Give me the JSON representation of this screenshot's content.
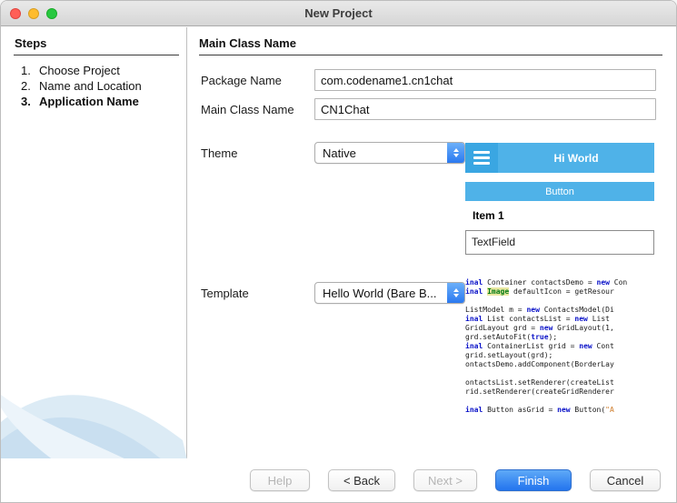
{
  "window": {
    "title": "New Project"
  },
  "colors": {
    "accent_blue": "#2f7cf6",
    "preview_header_blue": "#4fb2e8",
    "preview_burger_blue": "#3aa6e2",
    "keyword_blue": "#0a12c8",
    "string_orange": "#ce7b29",
    "highlight_bg": "#e9e7a1",
    "highlight_green": "#067d17"
  },
  "steps": {
    "heading": "Steps",
    "items": [
      {
        "num": "1.",
        "label": "Choose Project"
      },
      {
        "num": "2.",
        "label": "Name and Location"
      },
      {
        "num": "3.",
        "label": "Application Name"
      }
    ]
  },
  "main": {
    "heading": "Main Class Name",
    "package_label": "Package Name",
    "package_value": "com.codename1.cn1chat",
    "mainclass_label": "Main Class Name",
    "mainclass_value": "CN1Chat",
    "theme_label": "Theme",
    "theme_value": "Native",
    "template_label": "Template",
    "template_value": "Hello World (Bare B...",
    "theme_preview": {
      "title": "Hi World",
      "button": "Button",
      "item": "Item 1",
      "textfield": "TextField"
    },
    "code_lines": [
      [
        {
          "t": "inal ",
          "c": "k"
        },
        {
          "t": "Container contactsDemo = ",
          "c": "p"
        },
        {
          "t": "new",
          "c": "k"
        },
        {
          "t": " Con",
          "c": "p"
        }
      ],
      [
        {
          "t": "inal ",
          "c": "k"
        },
        {
          "t": "Image",
          "c": "h"
        },
        {
          "t": " defaultIcon = getResour",
          "c": "p"
        }
      ],
      [],
      [
        {
          "t": "ListModel m = ",
          "c": "p"
        },
        {
          "t": "new",
          "c": "k"
        },
        {
          "t": " ContactsModel(Di",
          "c": "p"
        }
      ],
      [
        {
          "t": "inal ",
          "c": "k"
        },
        {
          "t": "List contactsList = ",
          "c": "p"
        },
        {
          "t": "new",
          "c": "k"
        },
        {
          "t": " List",
          "c": "p"
        }
      ],
      [
        {
          "t": "GridLayout grd = ",
          "c": "p"
        },
        {
          "t": "new",
          "c": "k"
        },
        {
          "t": " GridLayout(1,",
          "c": "p"
        }
      ],
      [
        {
          "t": "grd.setAutoFit(",
          "c": "p"
        },
        {
          "t": "true",
          "c": "k"
        },
        {
          "t": ");",
          "c": "p"
        }
      ],
      [
        {
          "t": "inal ",
          "c": "k"
        },
        {
          "t": "ContainerList grid = ",
          "c": "p"
        },
        {
          "t": "new",
          "c": "k"
        },
        {
          "t": " Cont",
          "c": "p"
        }
      ],
      [
        {
          "t": "grid.setLayout(grd);",
          "c": "p"
        }
      ],
      [
        {
          "t": "ontactsDemo.addComponent(BorderLay",
          "c": "p"
        }
      ],
      [],
      [
        {
          "t": "ontactsList.setRenderer(createList",
          "c": "p"
        }
      ],
      [
        {
          "t": "rid.setRenderer(createGridRenderer",
          "c": "p"
        }
      ],
      [],
      [
        {
          "t": "inal ",
          "c": "k"
        },
        {
          "t": "Button asGrid = ",
          "c": "p"
        },
        {
          "t": "new",
          "c": "k"
        },
        {
          "t": " Button(",
          "c": "p"
        },
        {
          "t": "\"A",
          "c": "s"
        }
      ]
    ]
  },
  "footer": {
    "buttons": [
      {
        "label": "Help",
        "state": "disabled"
      },
      {
        "label": "< Back",
        "state": "enabled"
      },
      {
        "label": "Next >",
        "state": "disabled"
      },
      {
        "label": "Finish",
        "state": "primary"
      },
      {
        "label": "Cancel",
        "state": "enabled"
      }
    ]
  }
}
